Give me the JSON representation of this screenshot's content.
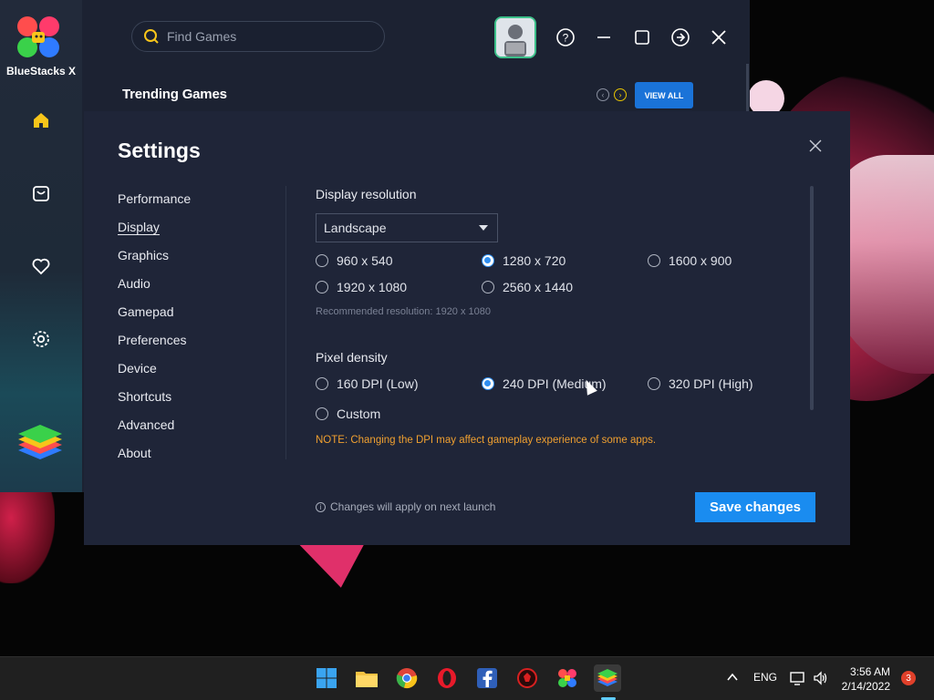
{
  "app": {
    "name": "BlueStacks X",
    "search_placeholder": "Find Games",
    "section_title": "Trending Games",
    "view_all_label": "VIEW ALL",
    "sidebar_icons": [
      "home-icon",
      "shop-bag-icon",
      "heart-icon",
      "gear-icon"
    ],
    "accent_color": "#1a73d8"
  },
  "settings": {
    "title": "Settings",
    "nav": [
      "Performance",
      "Display",
      "Graphics",
      "Audio",
      "Gamepad",
      "Preferences",
      "Device",
      "Shortcuts",
      "Advanced",
      "About"
    ],
    "active_nav": "Display",
    "display_resolution": {
      "label": "Display resolution",
      "orientation": "Landscape",
      "options": [
        "960 x 540",
        "1280 x 720",
        "1600 x 900",
        "1920 x 1080",
        "2560 x 1440"
      ],
      "selected": "1280 x 720",
      "recommended": "Recommended resolution: 1920 x 1080"
    },
    "pixel_density": {
      "label": "Pixel density",
      "options": [
        "160 DPI (Low)",
        "240 DPI (Medium)",
        "320 DPI (High)",
        "Custom"
      ],
      "selected": "240 DPI (Medium)",
      "note": "NOTE: Changing the DPI may affect gameplay experience of some apps."
    },
    "footer_info": "Changes will apply on next launch",
    "save_label": "Save changes"
  },
  "taskbar": {
    "apps": [
      "windows-start-icon",
      "file-explorer-icon",
      "chrome-icon",
      "opera-icon",
      "facebook-icon",
      "game-app-icon",
      "bluestacks-x-icon",
      "bluestacks-icon"
    ],
    "language": "ENG",
    "time": "3:56 AM",
    "date": "2/14/2022",
    "notification_count": "3"
  }
}
